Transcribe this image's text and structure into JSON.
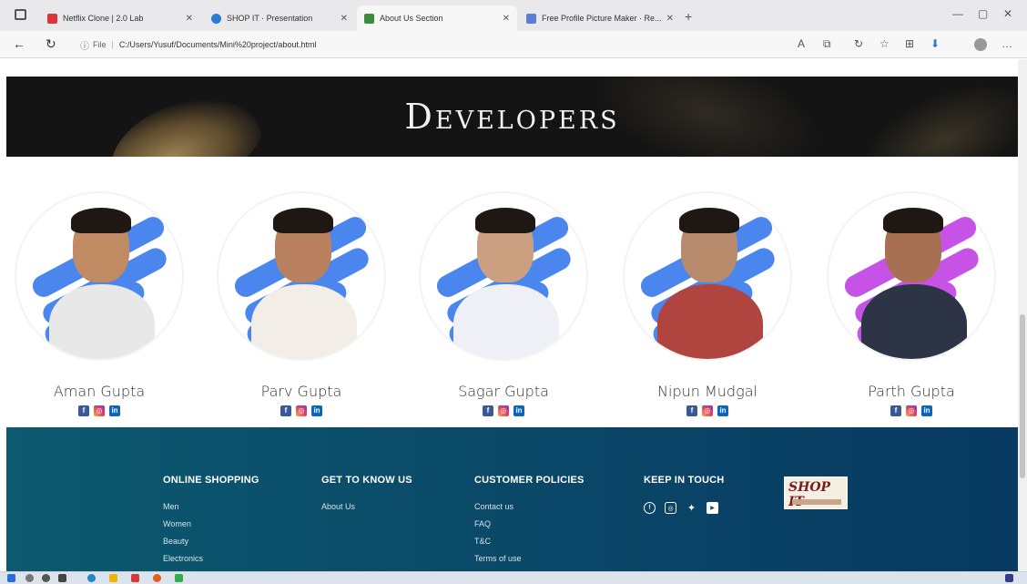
{
  "browser": {
    "tabs": [
      {
        "title": "Netflix Clone | 2.0 Lab",
        "favicon_color": "#d9363e",
        "active": false
      },
      {
        "title": "SHOP IT · Presentation",
        "favicon_color": "#2b7bd6",
        "active": false
      },
      {
        "title": "About Us Section",
        "favicon_color": "#3c8e3c",
        "active": true
      },
      {
        "title": "Free Profile Picture Maker · Re...",
        "favicon_color": "#5b7fd6",
        "active": false
      }
    ],
    "new_tab_label": "+",
    "address": {
      "file_label": "File",
      "url": "C:/Users/Yusuf/Documents/Mini%20project/about.html"
    }
  },
  "hero": {
    "title": "Developers"
  },
  "developers": [
    {
      "name": "Aman Gupta",
      "stroke_color": "#4a86ee",
      "shirt_color": "#e8e8e8",
      "skin": "#c08a63"
    },
    {
      "name": "Parv Gupta",
      "stroke_color": "#4a86ee",
      "shirt_color": "#f2ede6",
      "skin": "#b98160"
    },
    {
      "name": "Sagar Gupta",
      "stroke_color": "#4a86ee",
      "shirt_color": "#eef0f5",
      "skin": "#caa081"
    },
    {
      "name": "Nipun Mudgal",
      "stroke_color": "#4a86ee",
      "shirt_color": "#b0453f",
      "skin": "#b88b6c"
    },
    {
      "name": "Parth Gupta",
      "stroke_color": "#c653e6",
      "shirt_color": "#2c3445",
      "skin": "#a87052"
    }
  ],
  "social_icons": [
    "facebook-icon",
    "instagram-icon",
    "linkedin-icon"
  ],
  "footer": {
    "columns": [
      {
        "heading": "ONLINE SHOPPING",
        "links": [
          "Men",
          "Women",
          "Beauty",
          "Electronics"
        ]
      },
      {
        "heading": "GET TO KNOW US",
        "links": [
          "About Us"
        ]
      },
      {
        "heading": "CUSTOMER POLICIES",
        "links": [
          "Contact us",
          "FAQ",
          "T&C",
          "Terms of use"
        ]
      },
      {
        "heading": "KEEP IN TOUCH",
        "links": []
      }
    ],
    "logo_text": "SHOP IT"
  },
  "colors": {
    "footer_bg": "#0a4868",
    "hero_bg": "#141414",
    "accent_blue": "#4a86ee",
    "accent_purple": "#c653e6"
  }
}
